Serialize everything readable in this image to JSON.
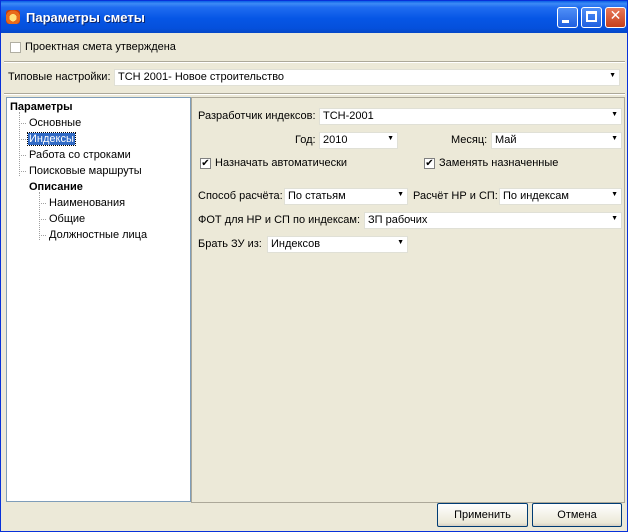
{
  "window": {
    "title": "Параметры сметы"
  },
  "approved_checkbox": {
    "label": "Проектная смета утверждена",
    "checked": false
  },
  "preset": {
    "label": "Типовые настройки:",
    "value": "ТСН 2001- Новое строительство"
  },
  "tree": {
    "items": [
      {
        "label": "Параметры"
      },
      {
        "label": "Основные"
      },
      {
        "label": "Индексы"
      },
      {
        "label": "Работа со строками"
      },
      {
        "label": "Поисковые маршруты"
      },
      {
        "label": "Описание"
      },
      {
        "label": "Наименования"
      },
      {
        "label": "Общие"
      },
      {
        "label": "Должностные лица"
      }
    ],
    "selected_index": 2
  },
  "indices": {
    "developer_label": "Разработчик индексов:",
    "developer_value": "ТСН-2001",
    "year_label": "Год:",
    "year_value": "2010",
    "month_label": "Месяц:",
    "month_value": "Май",
    "auto_assign_label": "Назначать автоматически",
    "auto_assign_checked": true,
    "replace_assigned_label": "Заменять назначенные",
    "replace_assigned_checked": true,
    "calc_method_label": "Способ расчёта:",
    "calc_method_value": "По статьям",
    "nr_sp_label": "Расчёт НР и СП:",
    "nr_sp_value": "По индексам",
    "fot_label": "ФОТ для НР и СП по индексам:",
    "fot_value": "ЗП рабочих",
    "zu_label": "Брать ЗУ из:",
    "zu_value": "Индексов"
  },
  "buttons": {
    "apply": "Применить",
    "cancel": "Отмена"
  },
  "glyphs": {
    "check": "✔",
    "arrow": "▼",
    "close": "✕"
  }
}
